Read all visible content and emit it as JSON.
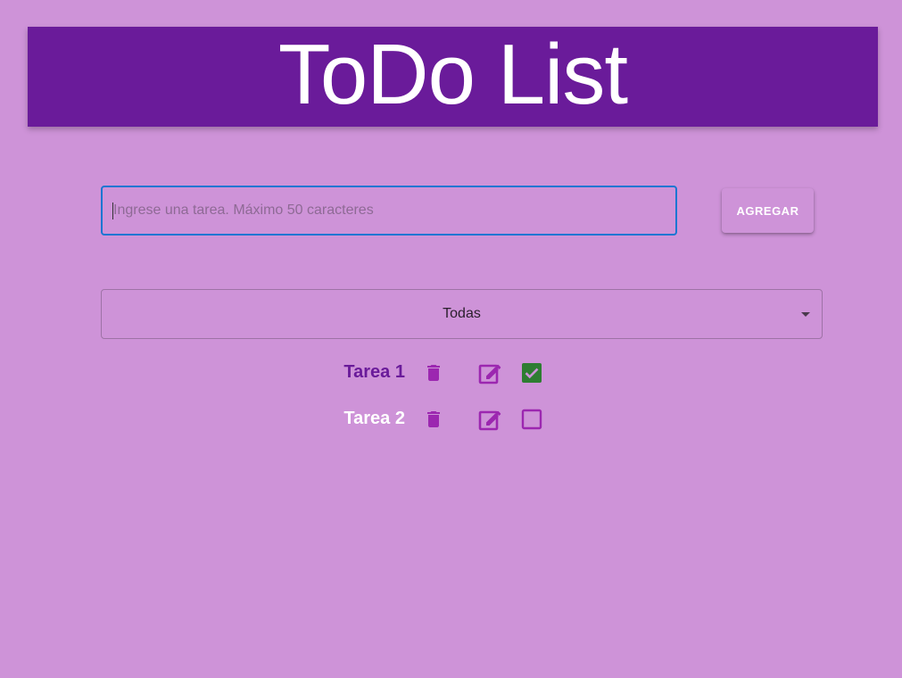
{
  "header": {
    "title": "ToDo List"
  },
  "input": {
    "placeholder": "Ingrese una tarea. Máximo 50 caracteres",
    "value": ""
  },
  "add_button": {
    "label": "AGREGAR"
  },
  "filter": {
    "selected": "Todas"
  },
  "tasks": [
    {
      "label": "Tarea 1",
      "completed": true
    },
    {
      "label": "Tarea 2",
      "completed": false
    }
  ],
  "colors": {
    "background": "#ce93d8",
    "header": "#6a1b9a",
    "icon": "#9c27b0",
    "checkbox_checked": "#2e7d32",
    "input_focus": "#1976d2"
  },
  "icons": {
    "delete": "trash-icon",
    "edit": "edit-icon",
    "checked": "checkbox-checked-icon",
    "unchecked": "checkbox-unchecked-icon",
    "dropdown": "chevron-down-icon"
  }
}
